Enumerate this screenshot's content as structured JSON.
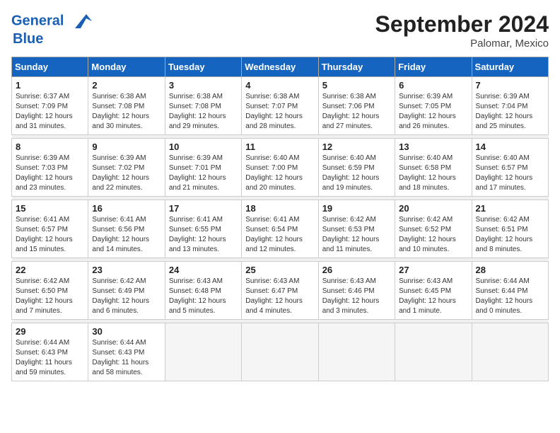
{
  "header": {
    "logo_line1": "General",
    "logo_line2": "Blue",
    "month_title": "September 2024",
    "subtitle": "Palomar, Mexico"
  },
  "weekdays": [
    "Sunday",
    "Monday",
    "Tuesday",
    "Wednesday",
    "Thursday",
    "Friday",
    "Saturday"
  ],
  "weeks": [
    [
      {
        "day": "1",
        "rise": "6:37 AM",
        "set": "7:09 PM",
        "daylight": "12 hours and 31 minutes."
      },
      {
        "day": "2",
        "rise": "6:38 AM",
        "set": "7:08 PM",
        "daylight": "12 hours and 30 minutes."
      },
      {
        "day": "3",
        "rise": "6:38 AM",
        "set": "7:08 PM",
        "daylight": "12 hours and 29 minutes."
      },
      {
        "day": "4",
        "rise": "6:38 AM",
        "set": "7:07 PM",
        "daylight": "12 hours and 28 minutes."
      },
      {
        "day": "5",
        "rise": "6:38 AM",
        "set": "7:06 PM",
        "daylight": "12 hours and 27 minutes."
      },
      {
        "day": "6",
        "rise": "6:39 AM",
        "set": "7:05 PM",
        "daylight": "12 hours and 26 minutes."
      },
      {
        "day": "7",
        "rise": "6:39 AM",
        "set": "7:04 PM",
        "daylight": "12 hours and 25 minutes."
      }
    ],
    [
      {
        "day": "8",
        "rise": "6:39 AM",
        "set": "7:03 PM",
        "daylight": "12 hours and 23 minutes."
      },
      {
        "day": "9",
        "rise": "6:39 AM",
        "set": "7:02 PM",
        "daylight": "12 hours and 22 minutes."
      },
      {
        "day": "10",
        "rise": "6:39 AM",
        "set": "7:01 PM",
        "daylight": "12 hours and 21 minutes."
      },
      {
        "day": "11",
        "rise": "6:40 AM",
        "set": "7:00 PM",
        "daylight": "12 hours and 20 minutes."
      },
      {
        "day": "12",
        "rise": "6:40 AM",
        "set": "6:59 PM",
        "daylight": "12 hours and 19 minutes."
      },
      {
        "day": "13",
        "rise": "6:40 AM",
        "set": "6:58 PM",
        "daylight": "12 hours and 18 minutes."
      },
      {
        "day": "14",
        "rise": "6:40 AM",
        "set": "6:57 PM",
        "daylight": "12 hours and 17 minutes."
      }
    ],
    [
      {
        "day": "15",
        "rise": "6:41 AM",
        "set": "6:57 PM",
        "daylight": "12 hours and 15 minutes."
      },
      {
        "day": "16",
        "rise": "6:41 AM",
        "set": "6:56 PM",
        "daylight": "12 hours and 14 minutes."
      },
      {
        "day": "17",
        "rise": "6:41 AM",
        "set": "6:55 PM",
        "daylight": "12 hours and 13 minutes."
      },
      {
        "day": "18",
        "rise": "6:41 AM",
        "set": "6:54 PM",
        "daylight": "12 hours and 12 minutes."
      },
      {
        "day": "19",
        "rise": "6:42 AM",
        "set": "6:53 PM",
        "daylight": "12 hours and 11 minutes."
      },
      {
        "day": "20",
        "rise": "6:42 AM",
        "set": "6:52 PM",
        "daylight": "12 hours and 10 minutes."
      },
      {
        "day": "21",
        "rise": "6:42 AM",
        "set": "6:51 PM",
        "daylight": "12 hours and 8 minutes."
      }
    ],
    [
      {
        "day": "22",
        "rise": "6:42 AM",
        "set": "6:50 PM",
        "daylight": "12 hours and 7 minutes."
      },
      {
        "day": "23",
        "rise": "6:42 AM",
        "set": "6:49 PM",
        "daylight": "12 hours and 6 minutes."
      },
      {
        "day": "24",
        "rise": "6:43 AM",
        "set": "6:48 PM",
        "daylight": "12 hours and 5 minutes."
      },
      {
        "day": "25",
        "rise": "6:43 AM",
        "set": "6:47 PM",
        "daylight": "12 hours and 4 minutes."
      },
      {
        "day": "26",
        "rise": "6:43 AM",
        "set": "6:46 PM",
        "daylight": "12 hours and 3 minutes."
      },
      {
        "day": "27",
        "rise": "6:43 AM",
        "set": "6:45 PM",
        "daylight": "12 hours and 1 minute."
      },
      {
        "day": "28",
        "rise": "6:44 AM",
        "set": "6:44 PM",
        "daylight": "12 hours and 0 minutes."
      }
    ],
    [
      {
        "day": "29",
        "rise": "6:44 AM",
        "set": "6:43 PM",
        "daylight": "11 hours and 59 minutes."
      },
      {
        "day": "30",
        "rise": "6:44 AM",
        "set": "6:43 PM",
        "daylight": "11 hours and 58 minutes."
      },
      null,
      null,
      null,
      null,
      null
    ]
  ]
}
